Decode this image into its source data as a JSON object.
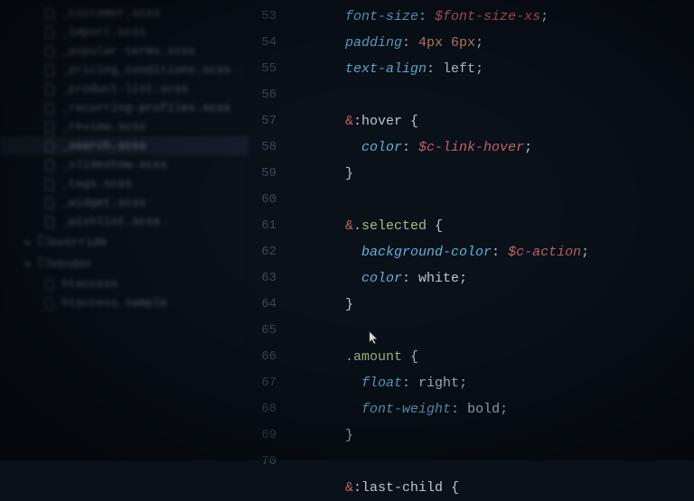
{
  "sidebar": {
    "files": [
      {
        "name": "_customer.scss",
        "selected": false
      },
      {
        "name": "_import.scss",
        "selected": false
      },
      {
        "name": "_popular-terms.scss",
        "selected": false
      },
      {
        "name": "_pricing_conditions.scss",
        "selected": false
      },
      {
        "name": "_product-list.scss",
        "selected": false
      },
      {
        "name": "_recurring-profiles.scss",
        "selected": false
      },
      {
        "name": "_review.scss",
        "selected": false
      },
      {
        "name": "_search.scss",
        "selected": true
      },
      {
        "name": "_slideshow.scss",
        "selected": false
      },
      {
        "name": "_tags.scss",
        "selected": false
      },
      {
        "name": "_widget.scss",
        "selected": false
      },
      {
        "name": "_wishlist.scss",
        "selected": false
      }
    ],
    "folders": [
      {
        "name": "override",
        "expanded": false
      },
      {
        "name": "vendor",
        "expanded": false
      }
    ],
    "footer_items": [
      {
        "name": "htaccess"
      },
      {
        "name": "htaccess.sample"
      }
    ]
  },
  "gutter": {
    "start": 53,
    "end": 70
  },
  "code": {
    "lines": [
      {
        "indent": 6,
        "segments": [
          {
            "t": "prop",
            "v": "font-size"
          },
          {
            "t": "punct",
            "v": ": "
          },
          {
            "t": "var",
            "v": "$font-size-xs"
          },
          {
            "t": "punct",
            "v": ";"
          }
        ]
      },
      {
        "indent": 6,
        "segments": [
          {
            "t": "prop",
            "v": "padding"
          },
          {
            "t": "punct",
            "v": ": "
          },
          {
            "t": "num",
            "v": "4px 6px"
          },
          {
            "t": "punct",
            "v": ";"
          }
        ]
      },
      {
        "indent": 6,
        "segments": [
          {
            "t": "prop",
            "v": "text-align"
          },
          {
            "t": "punct",
            "v": ": "
          },
          {
            "t": "val",
            "v": "left"
          },
          {
            "t": "punct",
            "v": ";"
          }
        ]
      },
      {
        "indent": 0,
        "segments": []
      },
      {
        "indent": 6,
        "segments": [
          {
            "t": "sel-amp",
            "v": "&"
          },
          {
            "t": "sel-class",
            "v": ":hover "
          },
          {
            "t": "punct",
            "v": "{"
          }
        ]
      },
      {
        "indent": 8,
        "segments": [
          {
            "t": "prop",
            "v": "color"
          },
          {
            "t": "punct",
            "v": ": "
          },
          {
            "t": "var",
            "v": "$c-link-hover"
          },
          {
            "t": "punct",
            "v": ";"
          }
        ]
      },
      {
        "indent": 6,
        "segments": [
          {
            "t": "punct",
            "v": "}"
          }
        ]
      },
      {
        "indent": 0,
        "segments": []
      },
      {
        "indent": 6,
        "segments": [
          {
            "t": "sel-amp",
            "v": "&"
          },
          {
            "t": "sel-green",
            "v": ".selected "
          },
          {
            "t": "punct",
            "v": "{"
          }
        ]
      },
      {
        "indent": 8,
        "segments": [
          {
            "t": "prop",
            "v": "background-color"
          },
          {
            "t": "punct",
            "v": ": "
          },
          {
            "t": "var",
            "v": "$c-action"
          },
          {
            "t": "punct",
            "v": ";"
          }
        ]
      },
      {
        "indent": 8,
        "segments": [
          {
            "t": "prop",
            "v": "color"
          },
          {
            "t": "punct",
            "v": ": "
          },
          {
            "t": "val",
            "v": "white"
          },
          {
            "t": "punct",
            "v": ";"
          }
        ]
      },
      {
        "indent": 6,
        "segments": [
          {
            "t": "punct",
            "v": "}"
          }
        ]
      },
      {
        "indent": 0,
        "segments": []
      },
      {
        "indent": 6,
        "segments": [
          {
            "t": "sel-green",
            "v": ".amount "
          },
          {
            "t": "punct",
            "v": "{"
          }
        ]
      },
      {
        "indent": 8,
        "segments": [
          {
            "t": "prop",
            "v": "float"
          },
          {
            "t": "punct",
            "v": ": "
          },
          {
            "t": "val",
            "v": "right"
          },
          {
            "t": "punct",
            "v": ";"
          }
        ]
      },
      {
        "indent": 8,
        "segments": [
          {
            "t": "prop",
            "v": "font-weight"
          },
          {
            "t": "punct",
            "v": ": "
          },
          {
            "t": "val",
            "v": "bold"
          },
          {
            "t": "punct",
            "v": ";"
          }
        ]
      },
      {
        "indent": 6,
        "segments": [
          {
            "t": "punct",
            "v": "}"
          }
        ]
      },
      {
        "indent": 0,
        "segments": []
      },
      {
        "indent": 6,
        "segments": [
          {
            "t": "sel-amp",
            "v": "&"
          },
          {
            "t": "sel-class",
            "v": ":last-child "
          },
          {
            "t": "punct",
            "v": "{"
          }
        ]
      }
    ]
  },
  "cursor": {
    "line_index": 13,
    "col": 3
  }
}
